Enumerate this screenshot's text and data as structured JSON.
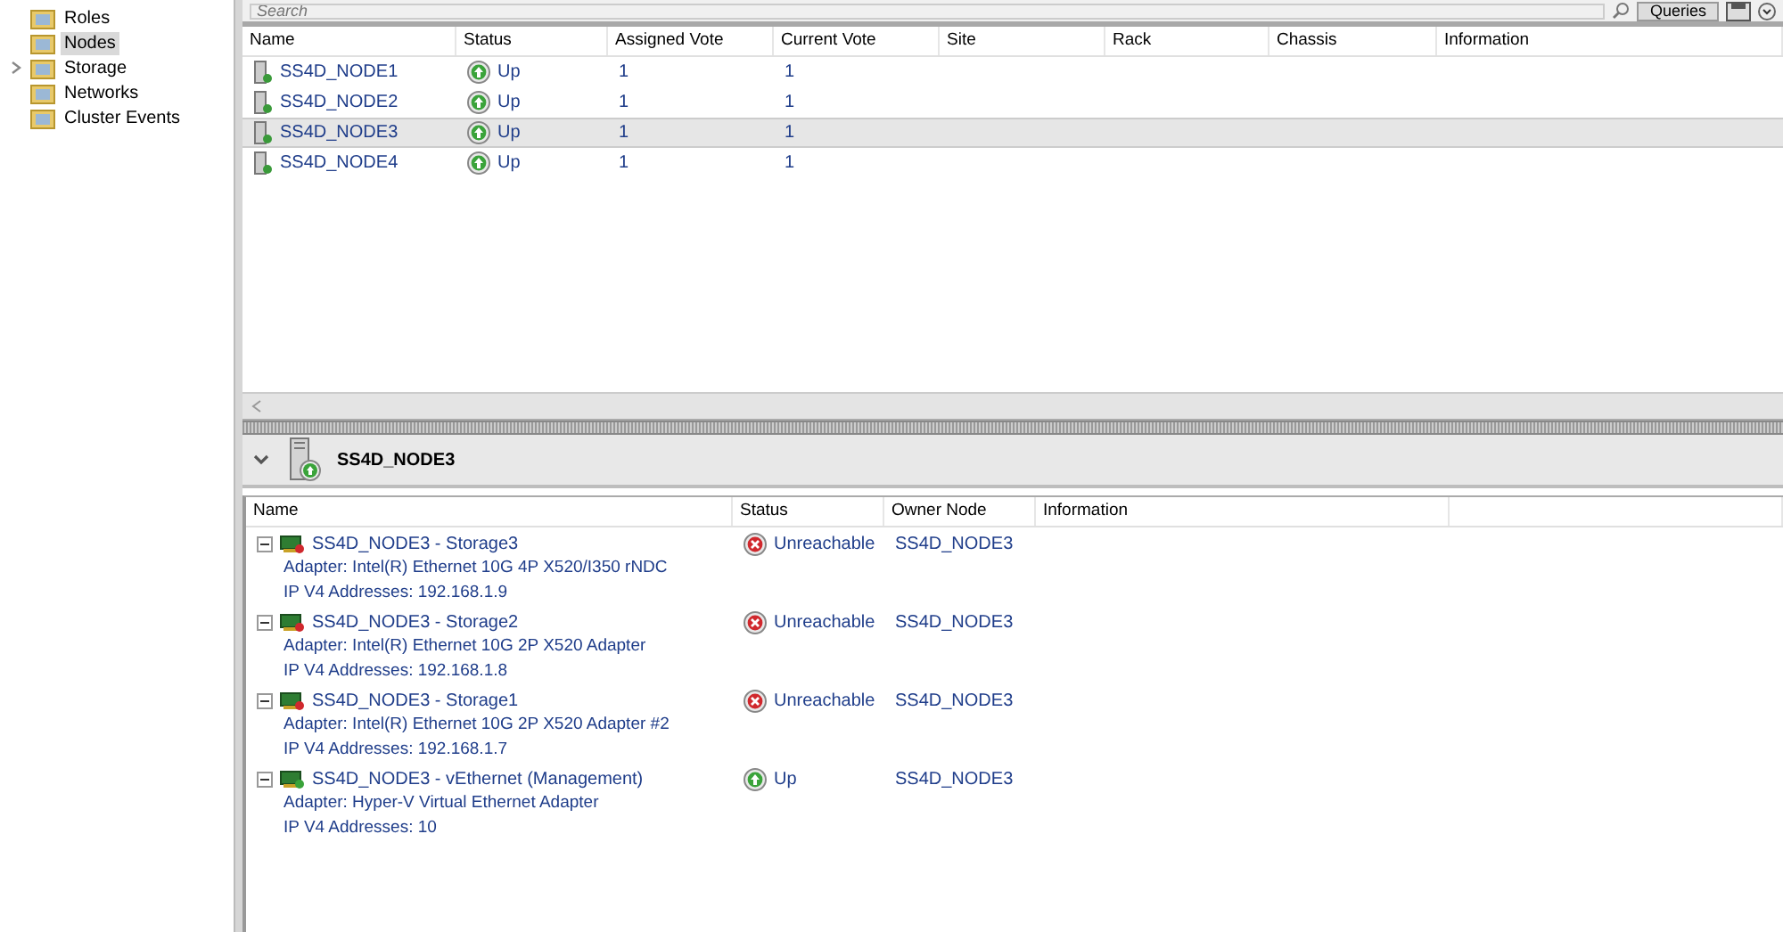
{
  "sidebar": {
    "items": [
      {
        "label": "Roles",
        "selected": false,
        "expandable": false
      },
      {
        "label": "Nodes",
        "selected": true,
        "expandable": false
      },
      {
        "label": "Storage",
        "selected": false,
        "expandable": true
      },
      {
        "label": "Networks",
        "selected": false,
        "expandable": false
      },
      {
        "label": "Cluster Events",
        "selected": false,
        "expandable": false
      }
    ]
  },
  "search": {
    "placeholder": "Search"
  },
  "queries_button": "Queries",
  "nodes_table": {
    "columns": [
      "Name",
      "Status",
      "Assigned Vote",
      "Current Vote",
      "Site",
      "Rack",
      "Chassis",
      "Information"
    ],
    "rows": [
      {
        "name": "SS4D_NODE1",
        "status": "Up",
        "kind": "up",
        "assigned_vote": "1",
        "current_vote": "1",
        "selected": false
      },
      {
        "name": "SS4D_NODE2",
        "status": "Up",
        "kind": "up",
        "assigned_vote": "1",
        "current_vote": "1",
        "selected": false
      },
      {
        "name": "SS4D_NODE3",
        "status": "Up",
        "kind": "up",
        "assigned_vote": "1",
        "current_vote": "1",
        "selected": true
      },
      {
        "name": "SS4D_NODE4",
        "status": "Up",
        "kind": "up",
        "assigned_vote": "1",
        "current_vote": "1",
        "selected": false
      }
    ]
  },
  "details": {
    "title": "SS4D_NODE3",
    "columns": [
      "Name",
      "Status",
      "Owner Node",
      "Information"
    ],
    "rows": [
      {
        "name": "SS4D_NODE3 - Storage3",
        "adapter": "Adapter: Intel(R) Ethernet 10G 4P X520/I350 rNDC",
        "ip": "IP V4 Addresses: 192.168.1.9",
        "status": "Unreachable",
        "kind": "unreachable",
        "owner": "SS4D_NODE3",
        "expanded": true
      },
      {
        "name": "SS4D_NODE3 - Storage2",
        "adapter": "Adapter: Intel(R) Ethernet 10G 2P X520 Adapter",
        "ip": "IP V4 Addresses: 192.168.1.8",
        "status": "Unreachable",
        "kind": "unreachable",
        "owner": "SS4D_NODE3",
        "expanded": true
      },
      {
        "name": "SS4D_NODE3 - Storage1",
        "adapter": "Adapter: Intel(R) Ethernet 10G 2P X520 Adapter #2",
        "ip": "IP V4 Addresses: 192.168.1.7",
        "status": "Unreachable",
        "kind": "unreachable",
        "owner": "SS4D_NODE3",
        "expanded": true
      },
      {
        "name": "SS4D_NODE3 - vEthernet (Management)",
        "adapter": "Adapter: Hyper-V Virtual Ethernet Adapter",
        "ip": "IP V4 Addresses: 10",
        "status": "Up",
        "kind": "up",
        "owner": "SS4D_NODE3",
        "expanded": true
      }
    ]
  }
}
